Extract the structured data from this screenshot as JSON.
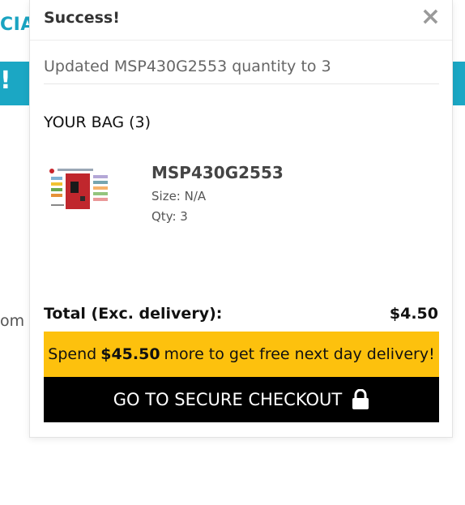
{
  "background": {
    "brand_fragment": "CIA",
    "banner_fragment": "!",
    "text_fragment": "om T",
    "banner_color": "#1ba7c4"
  },
  "modal": {
    "title": "Success!",
    "close_label": "×",
    "notice": "Updated MSP430G2553 quantity to 3",
    "bag_heading": "YOUR BAG (3)",
    "items": [
      {
        "name": "MSP430G2553",
        "size": "Size: N/A",
        "qty": "Qty: 3",
        "thumbnail_icon": "product-board-thumbnail"
      }
    ],
    "total_label": "Total (Exc. delivery):",
    "total_value": "$4.50",
    "promo": {
      "prefix": "Spend",
      "amount": "$45.50",
      "suffix": "more to get free next day delivery!",
      "color": "#fdc10d"
    },
    "checkout_label": "GO TO SECURE CHECKOUT",
    "checkout_icon": "lock-icon"
  }
}
